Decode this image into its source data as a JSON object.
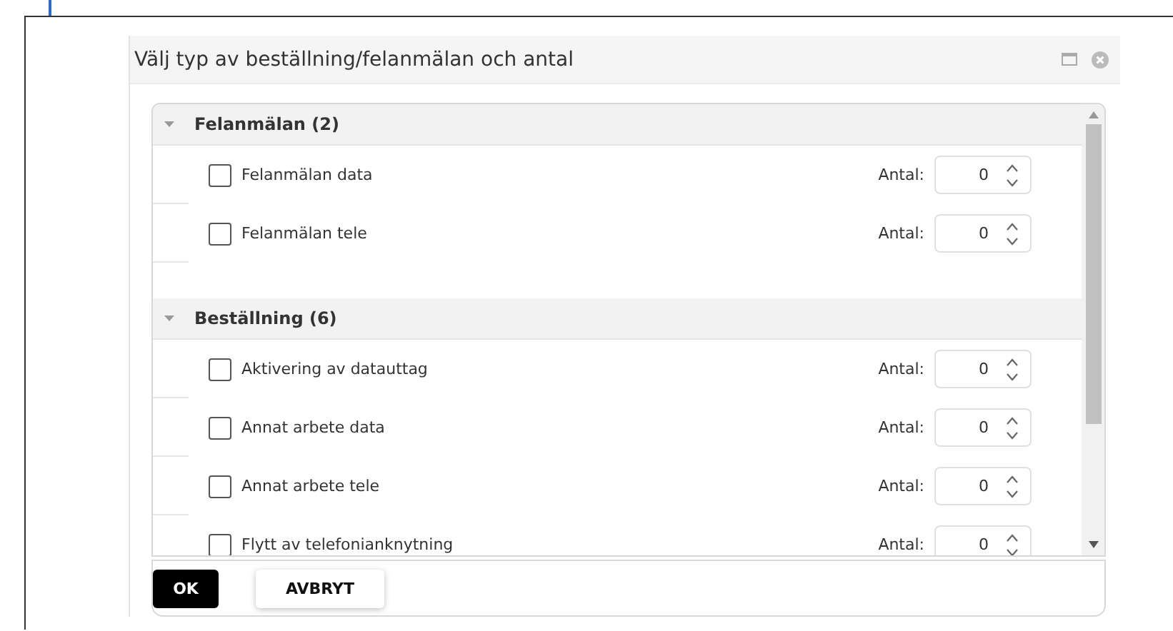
{
  "dialog": {
    "title": "Välj typ av beställning/felanmälan och antal"
  },
  "groups": [
    {
      "title": "Felanmälan (2)",
      "expanded": true,
      "items": [
        {
          "label": "Felanmälan data",
          "checked": false,
          "quantity_label": "Antal:",
          "quantity": "0"
        },
        {
          "label": "Felanmälan tele",
          "checked": false,
          "quantity_label": "Antal:",
          "quantity": "0"
        }
      ]
    },
    {
      "title": "Beställning (6)",
      "expanded": true,
      "items": [
        {
          "label": "Aktivering av datauttag",
          "checked": false,
          "quantity_label": "Antal:",
          "quantity": "0"
        },
        {
          "label": "Annat arbete data",
          "checked": false,
          "quantity_label": "Antal:",
          "quantity": "0"
        },
        {
          "label": "Annat arbete tele",
          "checked": false,
          "quantity_label": "Antal:",
          "quantity": "0"
        },
        {
          "label": "Flytt av telefonianknytning",
          "checked": false,
          "quantity_label": "Antal:",
          "quantity": "0"
        }
      ]
    }
  ],
  "buttons": [
    {
      "label": "OK",
      "kind": "primary"
    },
    {
      "label": "AVBRYT",
      "kind": "secondary"
    }
  ]
}
